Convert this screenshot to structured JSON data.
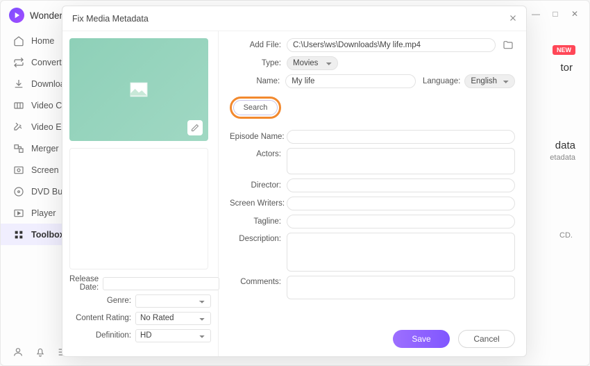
{
  "app": {
    "title": "Wonder"
  },
  "win_controls": {
    "min": "—",
    "max": "□",
    "close": "✕"
  },
  "sidebar": {
    "items": [
      {
        "label": "Home",
        "icon": "home-icon"
      },
      {
        "label": "Converter",
        "icon": "converter-icon"
      },
      {
        "label": "Downloader",
        "icon": "downloader-icon"
      },
      {
        "label": "Video Compressor",
        "icon": "compress-icon"
      },
      {
        "label": "Video Editor",
        "icon": "editor-icon"
      },
      {
        "label": "Merger",
        "icon": "merger-icon"
      },
      {
        "label": "Screen Recorder",
        "icon": "recorder-icon"
      },
      {
        "label": "DVD Burner",
        "icon": "dvd-icon"
      },
      {
        "label": "Player",
        "icon": "player-icon"
      },
      {
        "label": "Toolbox",
        "icon": "toolbox-icon"
      }
    ]
  },
  "bg": {
    "new": "NEW",
    "line1": "tor",
    "line2": "data",
    "line3": "etadata",
    "line4": "CD."
  },
  "modal": {
    "title": "Fix Media Metadata",
    "add_file_label": "Add File:",
    "add_file_value": "C:\\Users\\ws\\Downloads\\My life.mp4",
    "type_label": "Type:",
    "type_value": "Movies",
    "name_label": "Name:",
    "name_value": "My life",
    "language_label": "Language:",
    "language_value": "English",
    "search_label": "Search",
    "episode_label": "Episode Name:",
    "actors_label": "Actors:",
    "director_label": "Director:",
    "writers_label": "Screen Writers:",
    "tagline_label": "Tagline:",
    "description_label": "Description:",
    "comments_label": "Comments:",
    "left": {
      "release_label": "Release Date:",
      "genre_label": "Genre:",
      "rating_label": "Content Rating:",
      "rating_value": "No Rated",
      "definition_label": "Definition:",
      "definition_value": "HD"
    },
    "save": "Save",
    "cancel": "Cancel"
  }
}
